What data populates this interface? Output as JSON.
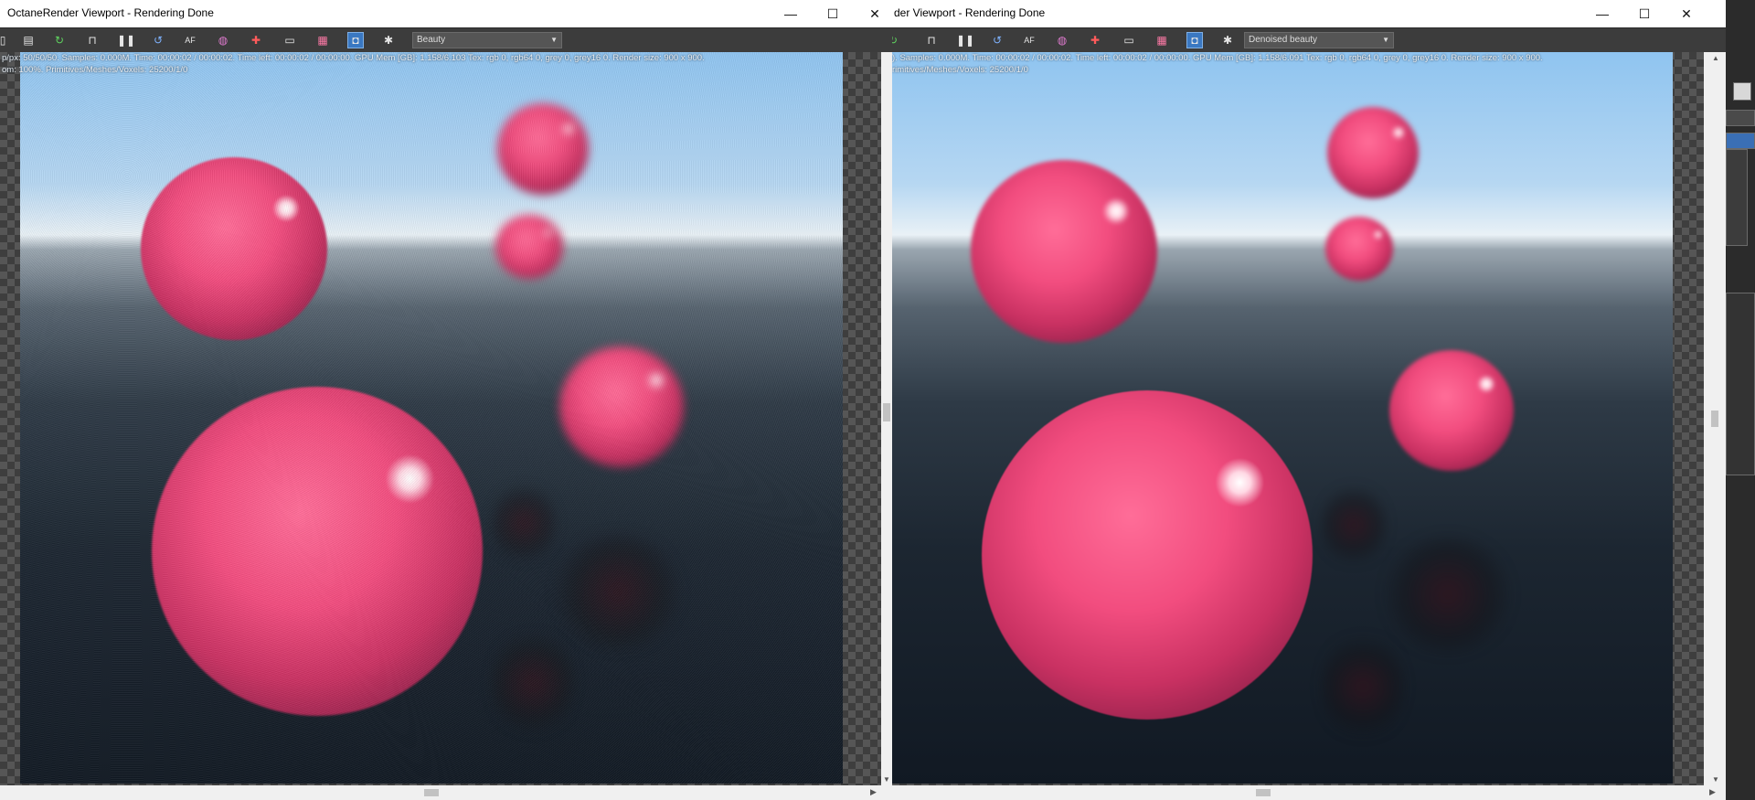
{
  "window1": {
    "title": "OctaneRender Viewport - Rendering Done",
    "controls": {
      "minimize": "—",
      "maximize": "☐",
      "close": "✕"
    },
    "pass_dropdown": "Beauty",
    "stats_line1": "p/px: 50/50/50.   Samples: 0.000M.   Time: 00:00:02 / 00:00:02.   Time left: 00:00:02 / 00:00:00.   GPU Mem [GB]: 1.158/6.103   Tex: rgb 0, rgb64 0, grey 0, grey16 0.   Render size: 900 x 900.",
    "stats_line2": "om: 100%.   Primitives/Meshes/Voxels: 25200/1/0"
  },
  "window2": {
    "title": "der Viewport - Rendering Done",
    "controls": {
      "minimize": "—",
      "maximize": "☐",
      "close": "✕"
    },
    "pass_dropdown": "Denoised beauty",
    "stats_line1": ").   Samples: 0.000M.   Time: 00:00:02 / 00:00:02.   Time left: 00:00:02 / 00:00:00.   GPU Mem [GB]: 1.158/6.091   Tex: rgb 0, rgb64 0, grey 0, grey16 0.   Render size: 900 x 900.",
    "stats_line2": "rimitives/Meshes/Voxels: 25200/1/0"
  },
  "toolbar_icons": [
    "doc-icon",
    "clipboard-icon",
    "refresh-green-icon",
    "lock-icon",
    "pause-icon",
    "reset-icon",
    "focus-picker-icon",
    "color-wheel-icon",
    "region-render-icon",
    "film-region-icon",
    "calendar-icon",
    "camera-icon",
    "settings-gear-icon"
  ],
  "colors": {
    "toolbar_bg": "#3c3c3c",
    "active_icon": "#3a78c2",
    "sphere": "#f24d7f"
  }
}
